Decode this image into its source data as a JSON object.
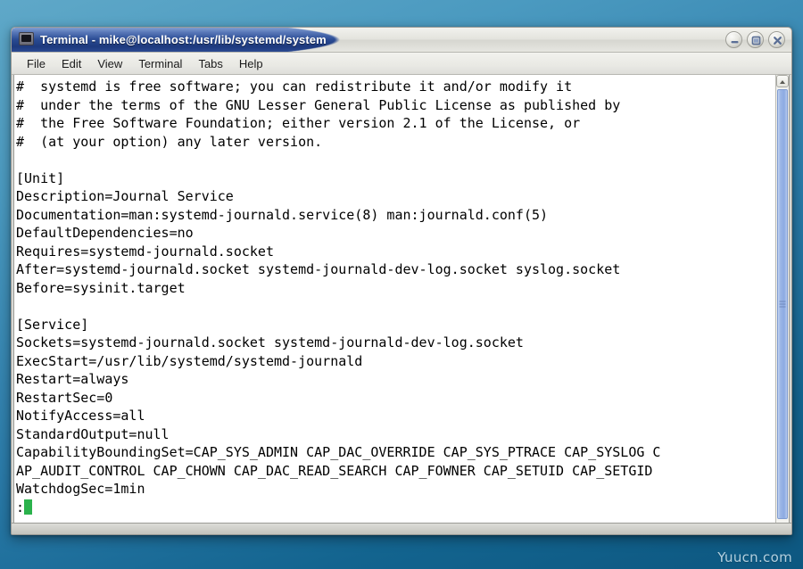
{
  "desktop": {
    "watermark": "Yuucn.com",
    "background_top": "#5fa8c8",
    "background_bottom": "#0d5780"
  },
  "window": {
    "title": "Terminal - mike@localhost:/usr/lib/systemd/system",
    "icon": "terminal-icon",
    "titlebar_color": "#27478f",
    "controls": [
      {
        "name": "minimize",
        "glyph": "minimize-icon"
      },
      {
        "name": "maximize",
        "glyph": "maximize-icon"
      },
      {
        "name": "close",
        "glyph": "close-icon"
      }
    ]
  },
  "menubar": {
    "items": [
      {
        "label": "File"
      },
      {
        "label": "Edit"
      },
      {
        "label": "View"
      },
      {
        "label": "Terminal"
      },
      {
        "label": "Tabs"
      },
      {
        "label": "Help"
      }
    ]
  },
  "terminal": {
    "background": "#ffffff",
    "foreground": "#000000",
    "cursor_color": "#2bb24c",
    "prompt": ":",
    "lines": [
      "#  systemd is free software; you can redistribute it and/or modify it",
      "#  under the terms of the GNU Lesser General Public License as published by",
      "#  the Free Software Foundation; either version 2.1 of the License, or",
      "#  (at your option) any later version.",
      "",
      "[Unit]",
      "Description=Journal Service",
      "Documentation=man:systemd-journald.service(8) man:journald.conf(5)",
      "DefaultDependencies=no",
      "Requires=systemd-journald.socket",
      "After=systemd-journald.socket systemd-journald-dev-log.socket syslog.socket",
      "Before=sysinit.target",
      "",
      "[Service]",
      "Sockets=systemd-journald.socket systemd-journald-dev-log.socket",
      "ExecStart=/usr/lib/systemd/systemd-journald",
      "Restart=always",
      "RestartSec=0",
      "NotifyAccess=all",
      "StandardOutput=null",
      "CapabilityBoundingSet=CAP_SYS_ADMIN CAP_DAC_OVERRIDE CAP_SYS_PTRACE CAP_SYSLOG C",
      "AP_AUDIT_CONTROL CAP_CHOWN CAP_DAC_READ_SEARCH CAP_FOWNER CAP_SETUID CAP_SETGID",
      "WatchdogSec=1min"
    ]
  },
  "scrollbar": {
    "up_arrow": "scroll-up-icon",
    "thumb_color": "#9ab5e6"
  }
}
